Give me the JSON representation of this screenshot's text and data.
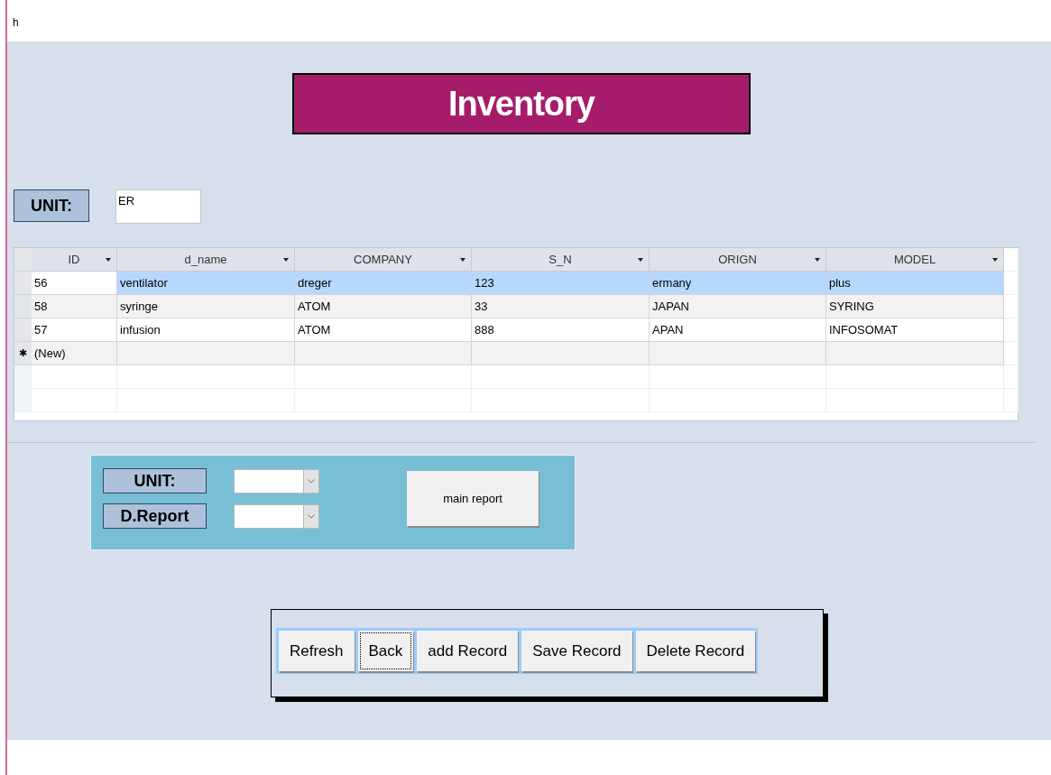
{
  "top_text": "h",
  "title": "Inventory",
  "unit": {
    "label": "UNIT:",
    "value": "ER"
  },
  "table": {
    "columns": [
      "ID",
      "d_name",
      "COMPANY",
      "S_N",
      "ORIGN",
      "MODEL"
    ],
    "rows": [
      {
        "selected": true,
        "cells": [
          "56",
          "ventilator",
          "dreger",
          "123",
          "ermany",
          "plus"
        ]
      },
      {
        "selected": false,
        "cells": [
          "58",
          "syringe",
          "ATOM",
          "33",
          "JAPAN",
          "SYRING"
        ]
      },
      {
        "selected": false,
        "cells": [
          "57",
          "infusion",
          "ATOM",
          "888",
          "APAN",
          "INFOSOMAT"
        ]
      }
    ],
    "new_row": {
      "marker": "✱",
      "label": "(New)"
    }
  },
  "report_panel": {
    "fields": [
      {
        "label": "UNIT:"
      },
      {
        "label": "D.Report"
      }
    ],
    "button": "main report"
  },
  "actions": [
    {
      "label": "Refresh",
      "focused": false
    },
    {
      "label": "Back",
      "focused": true
    },
    {
      "label": "add Record",
      "focused": false
    },
    {
      "label": "Save Record",
      "focused": false
    },
    {
      "label": "Delete Record",
      "focused": false
    }
  ]
}
